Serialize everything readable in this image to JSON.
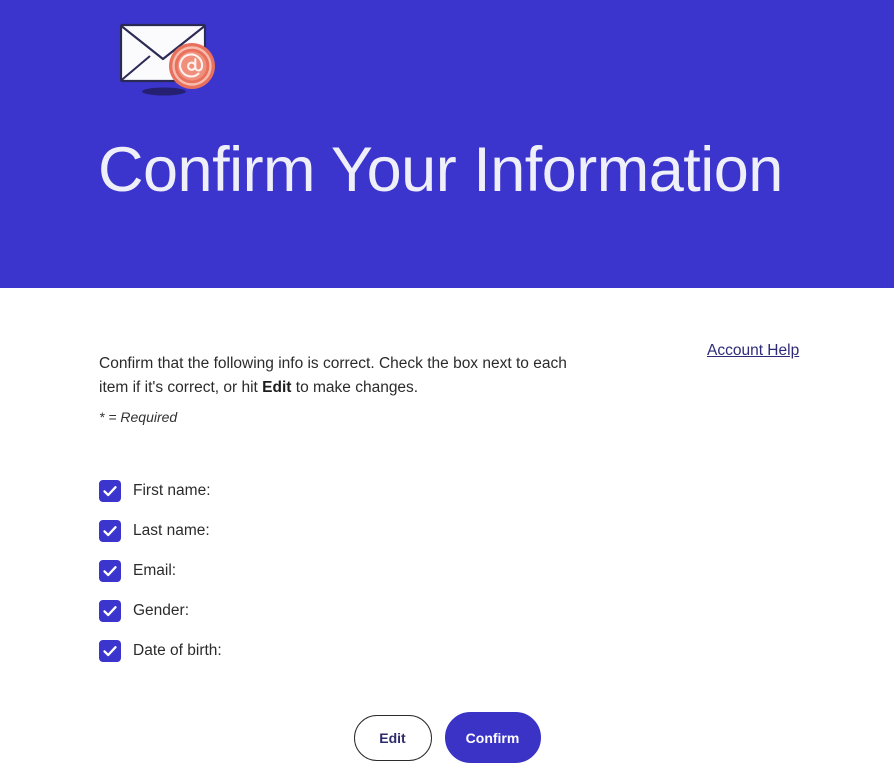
{
  "header": {
    "background_color": "#3B35CE",
    "title": "Confirm Your Information",
    "logo": {
      "icon_name": "email-envelope-at-icon",
      "envelope_fill": "#FBFBFD",
      "envelope_stroke": "#2B2A55",
      "badge_color": "#E8705C",
      "badge_inner_color": "#F4A391",
      "shadow_color": "#252072"
    }
  },
  "main": {
    "intro_text_part1": "Confirm that the following info is correct. Check the box next to each item if it's correct, or hit ",
    "intro_bold": "Edit",
    "intro_text_part2": " to make changes.",
    "account_help_link": "Account Help",
    "required_note": "* = Required",
    "checklist": [
      {
        "label": "First name:",
        "checked": true
      },
      {
        "label": "Last name:",
        "checked": true
      },
      {
        "label": "Email:",
        "checked": true
      },
      {
        "label": "Gender:",
        "checked": true
      },
      {
        "label": "Date of birth:",
        "checked": true
      }
    ],
    "checkbox_color": "#3B35CE",
    "checkmark_icon": "check-icon"
  },
  "actions": {
    "edit_label": "Edit",
    "confirm_label": "Confirm",
    "confirm_color": "#3A33C6",
    "edit_border_color": "#2b2b2b",
    "edit_text_color": "#2E2A6E"
  }
}
